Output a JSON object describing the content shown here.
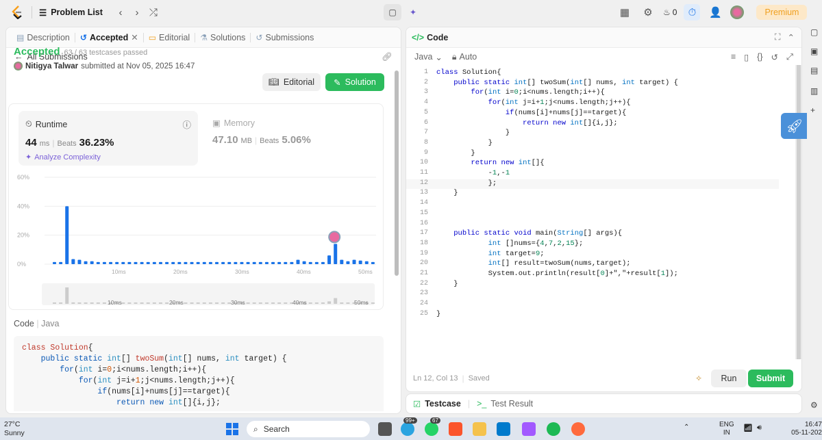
{
  "topbar": {
    "problem_list": "Problem List",
    "streak_count": "0",
    "premium": "Premium"
  },
  "left": {
    "tabs": [
      {
        "label": "Description"
      },
      {
        "label": "Accepted"
      },
      {
        "label": "Editorial"
      },
      {
        "label": "Solutions"
      },
      {
        "label": "Submissions"
      }
    ],
    "all_submissions": "All Submissions",
    "status": "Accepted",
    "testcases": "63 / 63 testcases passed",
    "user": "Nitigya Talwar",
    "submitted_text": "submitted at Nov 05, 2025 16:47",
    "editorial_btn": "Editorial",
    "solution_btn": "Solution",
    "runtime": {
      "title": "Runtime",
      "value": "44",
      "unit": "ms",
      "beats_label": "Beats",
      "beats": "36.23%"
    },
    "memory": {
      "title": "Memory",
      "value": "47.10",
      "unit": "MB",
      "beats_label": "Beats",
      "beats": "5.06%"
    },
    "analyze": "Analyze Complexity",
    "code_label": "Code",
    "code_lang": "Java"
  },
  "chart_data": {
    "type": "bar",
    "y_ticks": [
      "60%",
      "40%",
      "20%",
      "0%"
    ],
    "x_ticks": [
      "10ms",
      "20ms",
      "30ms",
      "40ms",
      "50ms"
    ],
    "mini_x_ticks": [
      "10ms",
      "20ms",
      "30ms",
      "40ms",
      "50ms"
    ],
    "ylim": [
      0,
      60
    ],
    "values": [
      1.5,
      1.5,
      40,
      3.5,
      3,
      2,
      2,
      1.5,
      1.5,
      1.5,
      1.5,
      1.5,
      1.5,
      1.5,
      1.5,
      1.5,
      1.5,
      1.5,
      1.5,
      1.5,
      1.5,
      1.5,
      1.5,
      1.5,
      1.5,
      1.5,
      1.5,
      1.5,
      1.5,
      1.5,
      1.5,
      1.5,
      1.5,
      1.5,
      1.5,
      1.5,
      1.5,
      1.5,
      1.5,
      3,
      2,
      1.5,
      1.5,
      1.5,
      6,
      14,
      3,
      2,
      3,
      2.5,
      2,
      1.5
    ],
    "highlight_index": 45,
    "accent": "#1a73e8"
  },
  "right": {
    "title": "Code",
    "language": "Java",
    "mode": "Auto",
    "status": "Ln 12, Col 13",
    "saved": "Saved",
    "run": "Run",
    "submit": "Submit",
    "testcase": "Testcase",
    "test_result": "Test Result"
  },
  "editor_lines": [
    "class Solution{",
    "    public static int[] twoSum(int[] nums, int target) {",
    "        for(int i=0;i<nums.length;i++){",
    "            for(int j=i+1;j<nums.length;j++){",
    "                if(nums[i]+nums[j]==target){",
    "                    return new int[]{i,j};",
    "                }",
    "            }",
    "        }",
    "        return new int[]{",
    "            -1,-1",
    "            };",
    "    }",
    "",
    "",
    "",
    "    public static void main(String[] args){",
    "            int []nums={4,7,2,15};",
    "            int target=9;",
    "            int[] result=twoSum(nums,target);",
    "            System.out.println(result[0]+\",\"+result[1]);",
    "    }",
    "",
    "",
    "}"
  ],
  "taskbar": {
    "temp": "27°C",
    "weather": "Sunny",
    "search": "Search",
    "badge1": "99+",
    "badge2": "67",
    "lang": "ENG",
    "region": "IN",
    "time": "16:47",
    "date": "05-11-202"
  }
}
